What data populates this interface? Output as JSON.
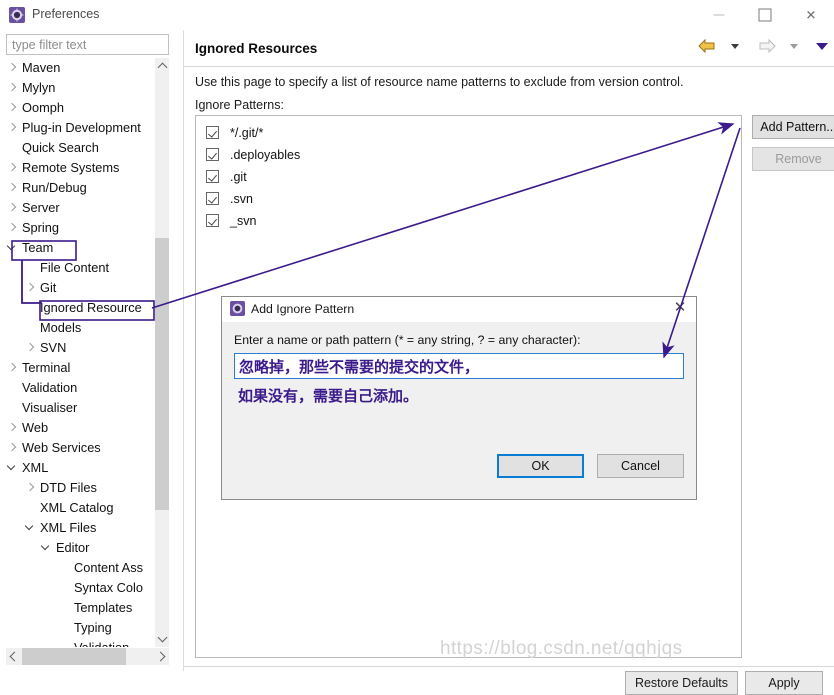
{
  "window": {
    "title": "Preferences",
    "icon": "preferences-gear-icon",
    "minimize_label": "–",
    "maximize_label": "□",
    "close_label": "✕"
  },
  "sidebar": {
    "filter": {
      "placeholder": "type filter text",
      "value": ""
    },
    "items": [
      {
        "label": "Maven",
        "indent": 0,
        "arrow": "collapsed"
      },
      {
        "label": "Mylyn",
        "indent": 0,
        "arrow": "collapsed"
      },
      {
        "label": "Oomph",
        "indent": 0,
        "arrow": "collapsed"
      },
      {
        "label": "Plug-in Development",
        "indent": 0,
        "arrow": "collapsed"
      },
      {
        "label": "Quick Search",
        "indent": 0,
        "arrow": "none"
      },
      {
        "label": "Remote Systems",
        "indent": 0,
        "arrow": "collapsed"
      },
      {
        "label": "Run/Debug",
        "indent": 0,
        "arrow": "collapsed"
      },
      {
        "label": "Server",
        "indent": 0,
        "arrow": "collapsed"
      },
      {
        "label": "Spring",
        "indent": 0,
        "arrow": "collapsed"
      },
      {
        "label": "Team",
        "indent": 0,
        "arrow": "expanded",
        "annotated": true
      },
      {
        "label": "File Content",
        "indent": 1,
        "arrow": "none"
      },
      {
        "label": "Git",
        "indent": 1,
        "arrow": "collapsed"
      },
      {
        "label": "Ignored Resource",
        "indent": 1,
        "arrow": "none",
        "annotated": true,
        "selected": true
      },
      {
        "label": "Models",
        "indent": 1,
        "arrow": "none"
      },
      {
        "label": "SVN",
        "indent": 1,
        "arrow": "collapsed"
      },
      {
        "label": "Terminal",
        "indent": 0,
        "arrow": "collapsed"
      },
      {
        "label": "Validation",
        "indent": 0,
        "arrow": "none"
      },
      {
        "label": "Visualiser",
        "indent": 0,
        "arrow": "none"
      },
      {
        "label": "Web",
        "indent": 0,
        "arrow": "collapsed"
      },
      {
        "label": "Web Services",
        "indent": 0,
        "arrow": "collapsed"
      },
      {
        "label": "XML",
        "indent": 0,
        "arrow": "expanded"
      },
      {
        "label": "DTD Files",
        "indent": 1,
        "arrow": "collapsed"
      },
      {
        "label": "XML Catalog",
        "indent": 1,
        "arrow": "none"
      },
      {
        "label": "XML Files",
        "indent": 1,
        "arrow": "expanded"
      },
      {
        "label": "Editor",
        "indent": 2,
        "arrow": "expanded"
      },
      {
        "label": "Content Ass",
        "indent": 3,
        "arrow": "none"
      },
      {
        "label": "Syntax Colo",
        "indent": 3,
        "arrow": "none"
      },
      {
        "label": "Templates",
        "indent": 3,
        "arrow": "none"
      },
      {
        "label": "Typing",
        "indent": 3,
        "arrow": "none"
      },
      {
        "label": "Validation",
        "indent": 3,
        "arrow": "none"
      }
    ]
  },
  "page": {
    "title": "Ignored Resources",
    "description": "Use this page to specify a list of resource name patterns to exclude from version control.",
    "list_label": "Ignore Patterns:",
    "patterns": [
      {
        "label": "*/.git/*",
        "checked": true
      },
      {
        "label": ".deployables",
        "checked": true
      },
      {
        "label": ".git",
        "checked": true
      },
      {
        "label": ".svn",
        "checked": true
      },
      {
        "label": "_svn",
        "checked": true
      }
    ],
    "side_buttons": [
      {
        "label": "Add Pattern...",
        "enabled": true
      },
      {
        "label": "Remove",
        "enabled": false
      }
    ],
    "nav": {
      "back_icon": "back-arrow-icon",
      "back_dropdown_icon": "chevron-down-icon",
      "forward_icon": "forward-arrow-icon",
      "forward_dropdown_icon": "chevron-down-icon",
      "menu_icon": "chevron-down-icon"
    },
    "footer_buttons": [
      {
        "label": "Restore Defaults"
      },
      {
        "label": "Apply"
      }
    ]
  },
  "dialog": {
    "icon": "preferences-gear-icon",
    "title": "Add Ignore Pattern",
    "close_label": "✕",
    "prompt": "Enter a name or path pattern (* = any string, ? = any character):",
    "input_value": "忽略掉，那些不需要的提交的文件，",
    "annotation_note": "如果没有，需要自己添加。",
    "ok_label": "OK",
    "cancel_label": "Cancel"
  },
  "watermark": {
    "text": "https://blog.csdn.net/qqhjqs"
  },
  "colors": {
    "annotation_purple": "#3b1a8c",
    "focus_blue": "#0a7cd4",
    "back_arrow_yellow": "#f2c14b",
    "forward_arrow_grey": "#c8c8c8"
  }
}
